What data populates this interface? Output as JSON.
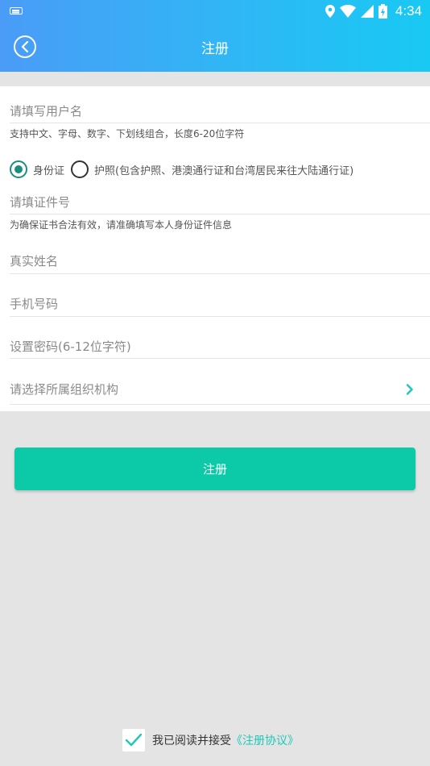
{
  "status_bar": {
    "time": "4:34"
  },
  "header": {
    "title": "注册"
  },
  "form": {
    "username_placeholder": "请填写用户名",
    "username_hint": "支持中文、字母、数字、下划线组合，长度6-20位字符",
    "id_type_options": [
      "身份证",
      "护照(包含护照、港澳通行证和台湾居民来往大陆通行证)"
    ],
    "id_type_selected": "身份证",
    "id_number_placeholder": "请填证件号",
    "id_number_hint": "为确保证书合法有效，请准确填写本人身份证件信息",
    "realname_placeholder": "真实姓名",
    "phone_placeholder": "手机号码",
    "password_placeholder": "设置密码(6-12位字符)",
    "organization_placeholder": "请选择所属组织机构"
  },
  "submit": {
    "label": "注册"
  },
  "agreement": {
    "text": "我已阅读并接受",
    "link": "《注册协议》",
    "checked": true
  },
  "colors": {
    "accent": "#0ccaa8",
    "radio": "#1a8f7e",
    "link": "#1ec8b8",
    "header_start": "#4a9cf7",
    "header_end": "#18c9f3"
  }
}
